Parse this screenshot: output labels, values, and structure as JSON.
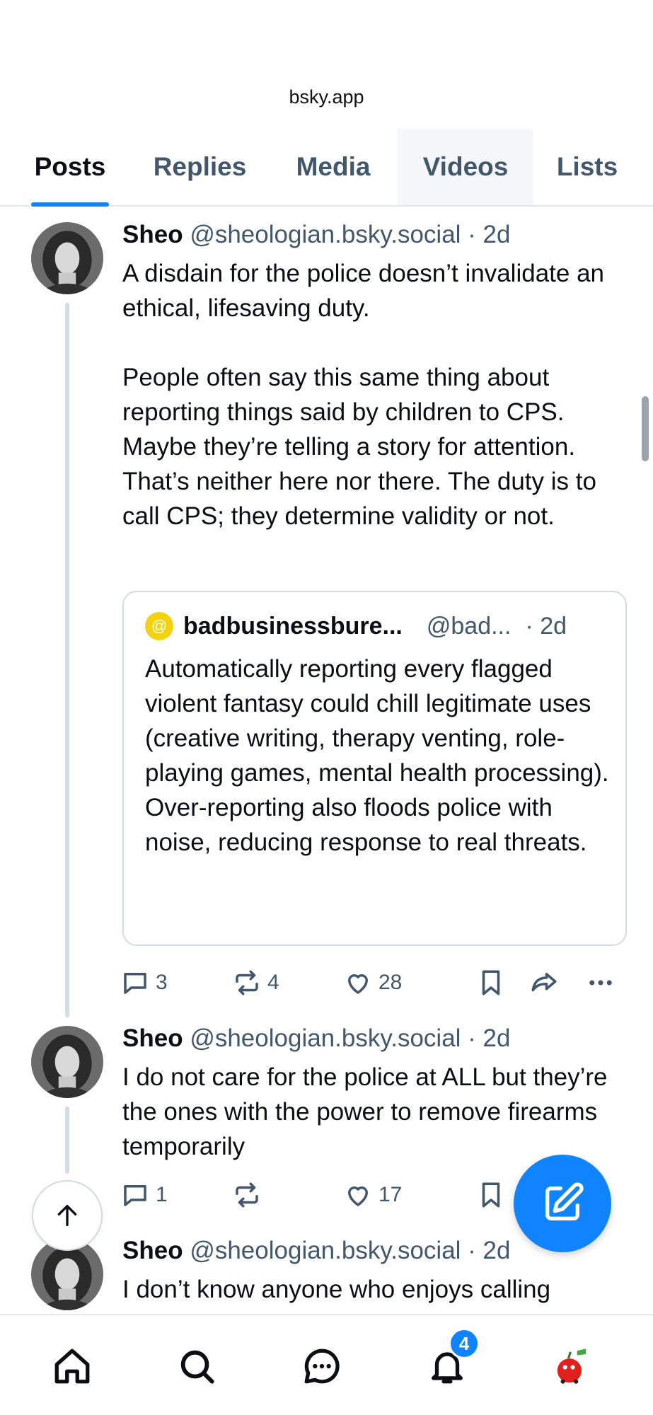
{
  "browser": {
    "url": "bsky.app"
  },
  "tabs": [
    {
      "label": "Posts"
    },
    {
      "label": "Replies"
    },
    {
      "label": "Media"
    },
    {
      "label": "Videos"
    },
    {
      "label": "Lists"
    }
  ],
  "posts": [
    {
      "name": "Sheo",
      "handle": "@sheologian.bsky.social · 2d",
      "text": "A disdain for the police doesn’t invalidate an ethical, lifesaving duty.\n\nPeople often say this same thing about reporting things said by children to CPS. Maybe they’re telling a story for attention. That’s neither here nor there. The duty is to call CPS; they determine validity or not.",
      "quote": {
        "name": "badbusinessbure...",
        "handle": "@bad...",
        "time": "· 2d",
        "text": "Automatically reporting every flagged violent fantasy could chill legitimate uses (creative writing, therapy venting, role-playing games, mental health processing). Over-reporting also floods police with noise, reducing response to real threats."
      },
      "replies": "3",
      "reposts": "4",
      "likes": "28"
    },
    {
      "name": "Sheo",
      "handle": "@sheologian.bsky.social · 2d",
      "text": "I do not care for the police at ALL but they’re the ones with the power to remove firearms temporarily",
      "replies": "1",
      "reposts": "",
      "likes": "17"
    },
    {
      "name": "Sheo",
      "handle": "@sheologian.bsky.social · 2d",
      "text": "I don’t know anyone who enjoys calling"
    }
  ],
  "notifications": {
    "badge_count": "4"
  },
  "colors": {
    "accent": "#1083fe",
    "muted_text": "#42576c",
    "border": "#d4dbe2"
  }
}
